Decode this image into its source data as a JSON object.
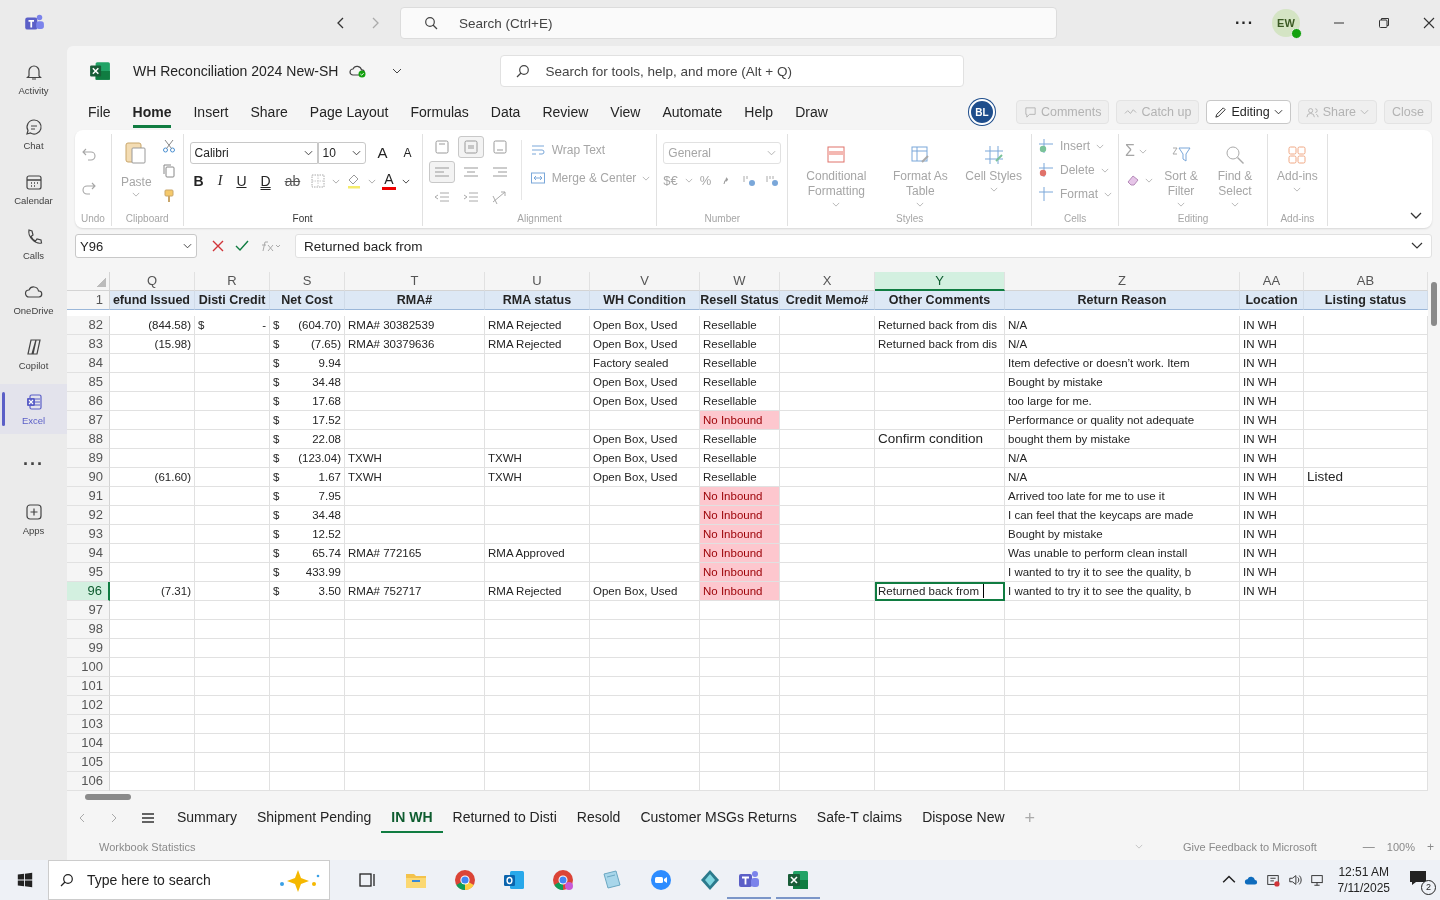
{
  "titlebar": {
    "search_placeholder": "Search (Ctrl+E)",
    "more": "···",
    "avatar": "EW"
  },
  "rail": [
    {
      "label": "Activity",
      "selected": false
    },
    {
      "label": "Chat",
      "selected": false
    },
    {
      "label": "Calendar",
      "selected": false
    },
    {
      "label": "Calls",
      "selected": false
    },
    {
      "label": "OneDrive",
      "selected": false
    },
    {
      "label": "Copilot",
      "selected": false
    },
    {
      "label": "Excel",
      "selected": true
    },
    {
      "label": "···",
      "selected": false
    },
    {
      "label": "Apps",
      "selected": false
    }
  ],
  "file": {
    "title": "WH Reconciliation 2024 New-SH",
    "search_placeholder": "Search for tools, help, and more (Alt + Q)"
  },
  "menu": [
    {
      "label": "File",
      "selected": false
    },
    {
      "label": "Home",
      "selected": true
    },
    {
      "label": "Insert",
      "selected": false
    },
    {
      "label": "Share",
      "selected": false
    },
    {
      "label": "Page Layout",
      "selected": false
    },
    {
      "label": "Formulas",
      "selected": false
    },
    {
      "label": "Data",
      "selected": false
    },
    {
      "label": "Review",
      "selected": false
    },
    {
      "label": "View",
      "selected": false
    },
    {
      "label": "Automate",
      "selected": false
    },
    {
      "label": "Help",
      "selected": false
    },
    {
      "label": "Draw",
      "selected": false
    }
  ],
  "collab": {
    "avatar": "BL",
    "buttons": [
      {
        "kind": "comments",
        "label": "Comments",
        "disabled": true
      },
      {
        "kind": "catchup",
        "label": "Catch up",
        "disabled": true
      },
      {
        "kind": "editing",
        "label": "Editing",
        "disabled": false
      },
      {
        "kind": "share",
        "label": "Share",
        "disabled": true
      },
      {
        "kind": "close",
        "label": "Close",
        "disabled": true
      }
    ]
  },
  "ribbon": [
    {
      "kind": "undo",
      "label": "Undo",
      "disabled": true
    },
    {
      "kind": "clipboard",
      "label": "Clipboard",
      "paste": "Paste",
      "disabled": true
    },
    {
      "kind": "font",
      "label": "Font",
      "font_name": "Calibri",
      "font_size": "10",
      "disabled": false,
      "buttons": [
        {
          "kind": "grow",
          "label": "A"
        },
        {
          "kind": "shrink",
          "label": "A"
        },
        {
          "kind": "bold",
          "label": "B"
        },
        {
          "kind": "italic",
          "label": "I"
        },
        {
          "kind": "underline",
          "label": "U"
        },
        {
          "kind": "double",
          "label": "D"
        },
        {
          "kind": "strike",
          "label": "ab"
        },
        {
          "kind": "color",
          "label": "A"
        }
      ]
    },
    {
      "kind": "alignment",
      "label": "Alignment",
      "wrap_text": "Wrap Text",
      "merge_center": "Merge & Center",
      "disabled": true,
      "vertical_align": [
        {
          "selected": false
        },
        {
          "selected": true
        },
        {
          "selected": false
        }
      ],
      "horizontal_align": [
        {
          "selected": true
        },
        {
          "selected": false
        },
        {
          "selected": false
        }
      ]
    },
    {
      "kind": "number",
      "label": "Number",
      "format": "General",
      "currency": "$€",
      "percent": "%",
      "disabled": true
    },
    {
      "kind": "styles",
      "label": "Styles",
      "items": [
        "Conditional Formatting",
        "Format As Table",
        "Cell Styles"
      ],
      "disabled": true
    },
    {
      "kind": "cells",
      "label": "Cells",
      "items": [
        "Insert",
        "Delete",
        "Format"
      ],
      "disabled": true
    },
    {
      "kind": "editing",
      "label": "Editing",
      "sum": "Σ",
      "items": [
        "Sort & Filter",
        "Find & Select"
      ],
      "disabled": true
    },
    {
      "kind": "addins",
      "label": "Add-ins",
      "item": "Add-ins",
      "disabled": true
    }
  ],
  "formula_bar": {
    "name_box": "Y96",
    "formula": "Returned back from"
  },
  "sheet": {
    "header_row": "1",
    "columns": [
      {
        "letter": "Q",
        "header": "efund Issued",
        "selected": false
      },
      {
        "letter": "R",
        "header": "Disti Credit",
        "selected": false
      },
      {
        "letter": "S",
        "header": "Net Cost",
        "selected": false
      },
      {
        "letter": "T",
        "header": "RMA#",
        "selected": false
      },
      {
        "letter": "U",
        "header": "RMA status",
        "selected": false
      },
      {
        "letter": "V",
        "header": "WH Condition",
        "selected": false
      },
      {
        "letter": "W",
        "header": "Resell Status",
        "selected": false
      },
      {
        "letter": "X",
        "header": "Credit Memo#",
        "selected": false
      },
      {
        "letter": "Y",
        "header": "Other Comments",
        "selected": true
      },
      {
        "letter": "Z",
        "header": "Return Reason",
        "selected": false
      },
      {
        "letter": "AA",
        "header": "Location",
        "selected": false
      },
      {
        "letter": "AB",
        "header": "Listing status",
        "selected": false
      }
    ],
    "rows": [
      {
        "number": "82",
        "selected": false,
        "cells": [
          "(844.58)",
          {
            "kind": "accounting",
            "currency": "$",
            "amount": "-"
          },
          {
            "kind": "accounting",
            "currency": "$",
            "amount": "(604.70)"
          },
          "RMA# 30382539",
          "RMA Rejected",
          "Open Box, Used",
          {
            "kind": "status",
            "text": "Resellable",
            "highlight": false
          },
          null,
          "Returned back from dis",
          "N/A",
          "IN WH",
          null
        ]
      },
      {
        "number": "83",
        "selected": false,
        "cells": [
          "(15.98)",
          null,
          {
            "kind": "accounting",
            "currency": "$",
            "amount": "(7.65)"
          },
          "RMA# 30379636",
          "RMA Rejected",
          "Open Box, Used",
          {
            "kind": "status",
            "text": "Resellable",
            "highlight": false
          },
          null,
          "Returned back from dis",
          "N/A",
          "IN WH",
          null
        ]
      },
      {
        "number": "84",
        "selected": false,
        "cells": [
          null,
          null,
          {
            "kind": "accounting",
            "currency": "$",
            "amount": "9.94"
          },
          null,
          null,
          "Factory sealed",
          {
            "kind": "status",
            "text": "Resellable",
            "highlight": false
          },
          null,
          null,
          "Item defective or doesn’t work. Item",
          "IN WH",
          null
        ]
      },
      {
        "number": "85",
        "selected": false,
        "cells": [
          null,
          null,
          {
            "kind": "accounting",
            "currency": "$",
            "amount": "34.48"
          },
          null,
          null,
          "Open Box, Used",
          {
            "kind": "status",
            "text": "Resellable",
            "highlight": false
          },
          null,
          null,
          "Bought by mistake",
          "IN WH",
          null
        ]
      },
      {
        "number": "86",
        "selected": false,
        "cells": [
          null,
          null,
          {
            "kind": "accounting",
            "currency": "$",
            "amount": "17.68"
          },
          null,
          null,
          "Open Box, Used",
          {
            "kind": "status",
            "text": "Resellable",
            "highlight": false
          },
          null,
          null,
          "too large for me.",
          "IN WH",
          null
        ]
      },
      {
        "number": "87",
        "selected": false,
        "cells": [
          null,
          null,
          {
            "kind": "accounting",
            "currency": "$",
            "amount": "17.52"
          },
          null,
          null,
          null,
          {
            "kind": "status",
            "text": "No Inbound",
            "highlight": true
          },
          null,
          null,
          "Performance or quality not adequate",
          "IN WH",
          null
        ]
      },
      {
        "number": "88",
        "selected": false,
        "cells": [
          null,
          null,
          {
            "kind": "accounting",
            "currency": "$",
            "amount": "22.08"
          },
          null,
          null,
          "Open Box, Used",
          {
            "kind": "status",
            "text": "Resellable",
            "highlight": false
          },
          null,
          {
            "kind": "note",
            "text": "Confirm condition"
          },
          "bought them by mistake",
          "IN WH",
          null
        ]
      },
      {
        "number": "89",
        "selected": false,
        "cells": [
          null,
          null,
          {
            "kind": "accounting",
            "currency": "$",
            "amount": "(123.04)"
          },
          "TXWH",
          "TXWH",
          "Open Box, Used",
          {
            "kind": "status",
            "text": "Resellable",
            "highlight": false
          },
          null,
          null,
          "N/A",
          "IN WH",
          null
        ]
      },
      {
        "number": "90",
        "selected": false,
        "cells": [
          "(61.60)",
          null,
          {
            "kind": "accounting",
            "currency": "$",
            "amount": "1.67"
          },
          "TXWH",
          "TXWH",
          "Open Box, Used",
          {
            "kind": "status",
            "text": "Resellable",
            "highlight": false
          },
          null,
          null,
          "N/A",
          "IN WH",
          {
            "kind": "note",
            "text": "Listed"
          }
        ]
      },
      {
        "number": "91",
        "selected": false,
        "cells": [
          null,
          null,
          {
            "kind": "accounting",
            "currency": "$",
            "amount": "7.95"
          },
          null,
          null,
          null,
          {
            "kind": "status",
            "text": "No Inbound",
            "highlight": true
          },
          null,
          null,
          "Arrived too late for me to use it",
          "IN WH",
          null
        ]
      },
      {
        "number": "92",
        "selected": false,
        "cells": [
          null,
          null,
          {
            "kind": "accounting",
            "currency": "$",
            "amount": "34.48"
          },
          null,
          null,
          null,
          {
            "kind": "status",
            "text": "No Inbound",
            "highlight": true
          },
          null,
          null,
          "I can feel that the keycaps are made",
          "IN WH",
          null
        ]
      },
      {
        "number": "93",
        "selected": false,
        "cells": [
          null,
          null,
          {
            "kind": "accounting",
            "currency": "$",
            "amount": "12.52"
          },
          null,
          null,
          null,
          {
            "kind": "status",
            "text": "No Inbound",
            "highlight": true
          },
          null,
          null,
          "Bought by mistake",
          "IN WH",
          null
        ]
      },
      {
        "number": "94",
        "selected": false,
        "cells": [
          null,
          null,
          {
            "kind": "accounting",
            "currency": "$",
            "amount": "65.74"
          },
          "RMA# 772165",
          "RMA Approved",
          null,
          {
            "kind": "status",
            "text": "No Inbound",
            "highlight": true
          },
          null,
          null,
          "Was unable to perform clean install",
          "IN WH",
          null
        ]
      },
      {
        "number": "95",
        "selected": false,
        "cells": [
          null,
          null,
          {
            "kind": "accounting",
            "currency": "$",
            "amount": "433.99"
          },
          null,
          null,
          null,
          {
            "kind": "status",
            "text": "No Inbound",
            "highlight": true
          },
          null,
          null,
          "I wanted to try it to see the quality, b",
          "IN WH",
          null
        ]
      },
      {
        "number": "96",
        "selected": true,
        "cells": [
          "(7.31)",
          null,
          {
            "kind": "accounting",
            "currency": "$",
            "amount": "3.50"
          },
          "RMA# 752717",
          "RMA Rejected",
          "Open Box, Used",
          {
            "kind": "status",
            "text": "No Inbound",
            "highlight": true
          },
          null,
          {
            "kind": "editing",
            "text": "Returned back from"
          },
          "I wanted to try it to see the quality, b",
          "IN WH",
          null
        ]
      },
      {
        "number": "97",
        "selected": false,
        "cells": []
      },
      {
        "number": "98",
        "selected": false,
        "cells": []
      },
      {
        "number": "99",
        "selected": false,
        "cells": []
      },
      {
        "number": "100",
        "selected": false,
        "cells": []
      },
      {
        "number": "101",
        "selected": false,
        "cells": []
      },
      {
        "number": "102",
        "selected": false,
        "cells": []
      },
      {
        "number": "103",
        "selected": false,
        "cells": []
      },
      {
        "number": "104",
        "selected": false,
        "cells": []
      },
      {
        "number": "105",
        "selected": false,
        "cells": []
      },
      {
        "number": "106",
        "selected": false,
        "cells": []
      }
    ]
  },
  "sheet_tabs": [
    {
      "label": "Summary",
      "selected": false
    },
    {
      "label": "Shipment Pending",
      "selected": false
    },
    {
      "label": "IN WH",
      "selected": true
    },
    {
      "label": "Returned to Disti",
      "selected": false
    },
    {
      "label": "Resold",
      "selected": false
    },
    {
      "label": "Customer MSGs Returns",
      "selected": false
    },
    {
      "label": "Safe-T claims",
      "selected": false
    },
    {
      "label": "Dispose New",
      "selected": false
    }
  ],
  "add_sheet": "+",
  "status_bar": {
    "left": "Workbook Statistics",
    "feedback": "Give Feedback to Microsoft",
    "zoom_out": "—",
    "zoom": "100%",
    "zoom_in": "+"
  },
  "taskbar": {
    "search_placeholder": "Type here to search",
    "time": "12:51 AM",
    "date": "7/11/2025",
    "notifications": "2"
  }
}
